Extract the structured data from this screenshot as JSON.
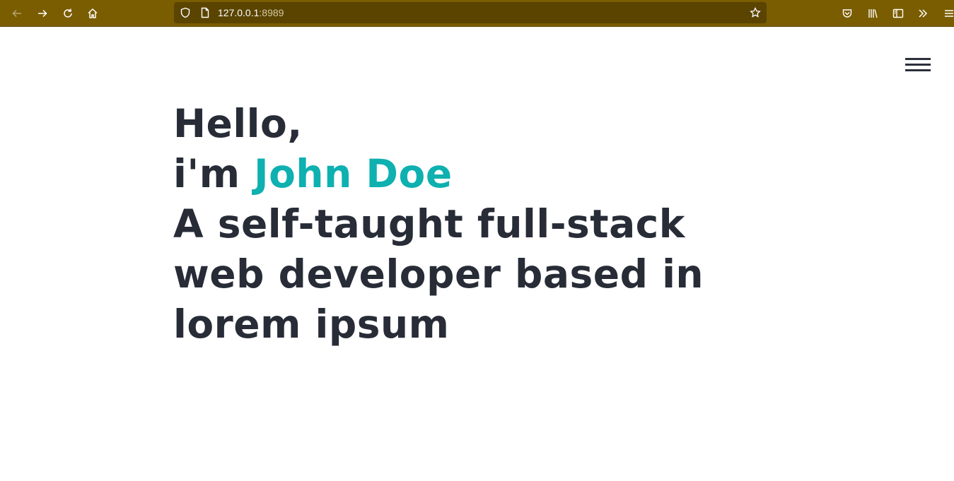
{
  "browser": {
    "url_host": "127.0.0.1",
    "url_port": ":8989",
    "colors": {
      "toolbar": "#7a5d00",
      "urlbar": "#5a4400"
    },
    "icons": [
      "back-icon",
      "forward-icon",
      "reload-icon",
      "home-icon",
      "shield-icon",
      "page-icon",
      "bookmark-star-icon",
      "pocket-icon",
      "library-icon",
      "sidebar-icon",
      "overflow-icon",
      "menu-icon"
    ]
  },
  "page": {
    "greeting": "Hello,",
    "intro_prefix": "i'm",
    "name": "John Doe",
    "tagline": "A self-taught full-stack web developer based in lorem ipsum",
    "colors": {
      "text": "#272c37",
      "accent": "#0eb0b0"
    }
  }
}
